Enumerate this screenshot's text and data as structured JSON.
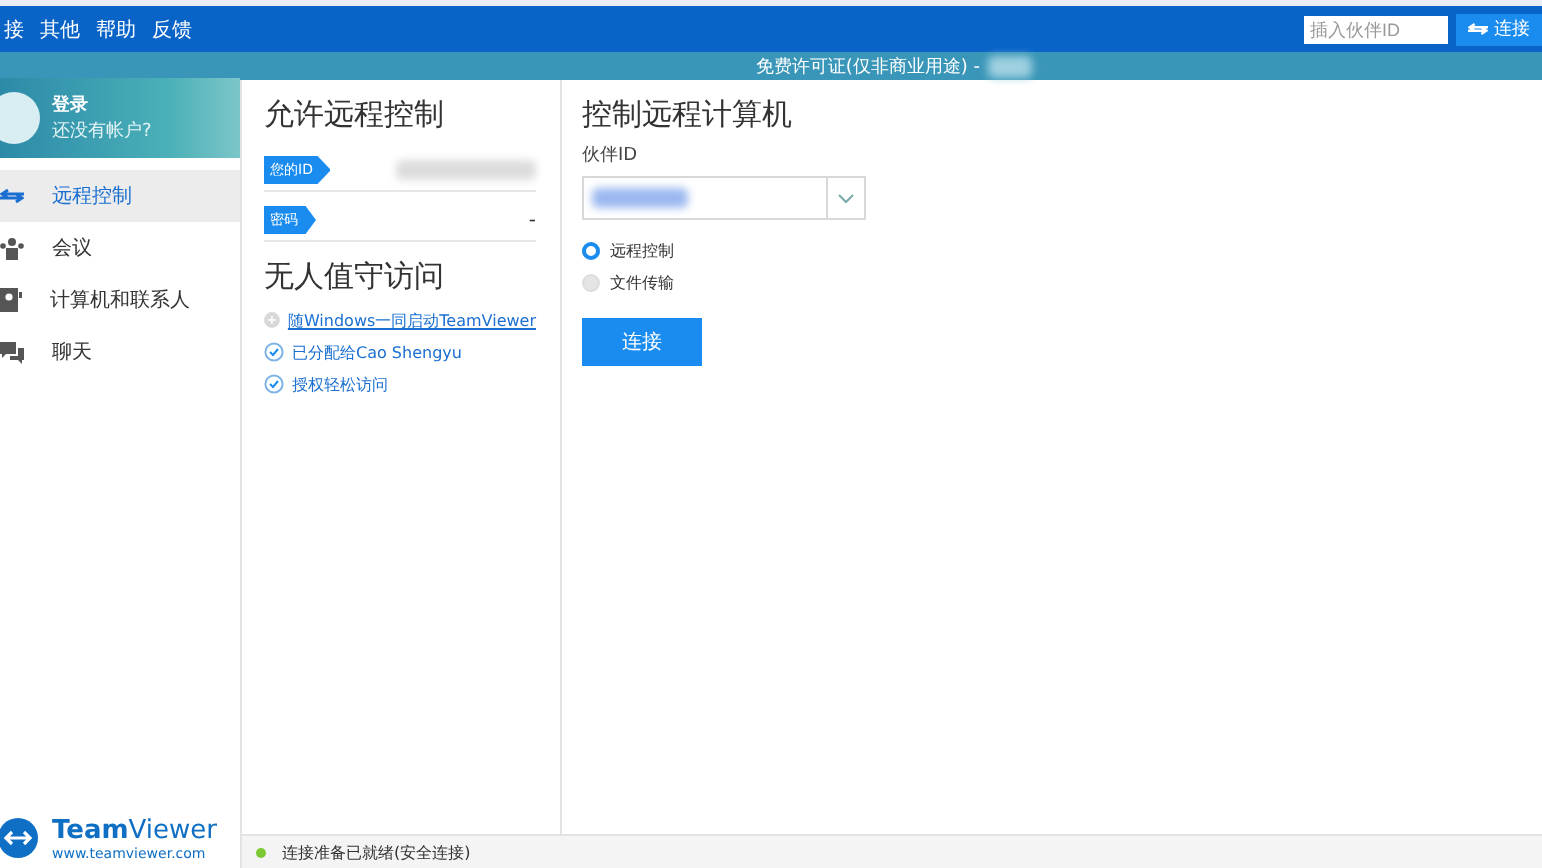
{
  "menu": [
    {
      "label": "接"
    },
    {
      "label": "其他"
    },
    {
      "label": "帮助"
    },
    {
      "label": "反馈"
    }
  ],
  "toolbar": {
    "partner_placeholder": "插入伙伴ID",
    "connect_button": "连接"
  },
  "license_bar": {
    "text": "免费许可证(仅非商业用途) -"
  },
  "profile": {
    "title": "登录",
    "subtitle": "还没有帐户?"
  },
  "nav": [
    {
      "label": "远程控制",
      "kind": "arrows",
      "selected": true
    },
    {
      "label": "会议",
      "kind": "people",
      "selected": false
    },
    {
      "label": "计算机和联系人",
      "kind": "contact",
      "selected": false
    },
    {
      "label": "聊天",
      "kind": "chat",
      "selected": false
    }
  ],
  "brand": {
    "name_bold": "Team",
    "name_light": "Viewer",
    "url": "www.teamviewer.com"
  },
  "allow": {
    "title": "允许远程控制",
    "id_label": "您的ID",
    "password_label": "密码",
    "password_value": "-"
  },
  "unattended": {
    "title": "无人值守访问",
    "items": [
      {
        "label": "随Windows一同启动TeamViewer",
        "done": false,
        "link": true
      },
      {
        "label": "已分配给Cao Shengyu",
        "done": true,
        "link": false
      },
      {
        "label": "授权轻松访问",
        "done": true,
        "link": false
      }
    ]
  },
  "control": {
    "title": "控制远程计算机",
    "partner_label": "伙伴ID",
    "modes": [
      {
        "label": "远程控制",
        "selected": true
      },
      {
        "label": "文件传输",
        "selected": false
      }
    ],
    "connect_button": "连接"
  },
  "status_bar": {
    "text": "连接准备已就绪(安全连接)"
  }
}
